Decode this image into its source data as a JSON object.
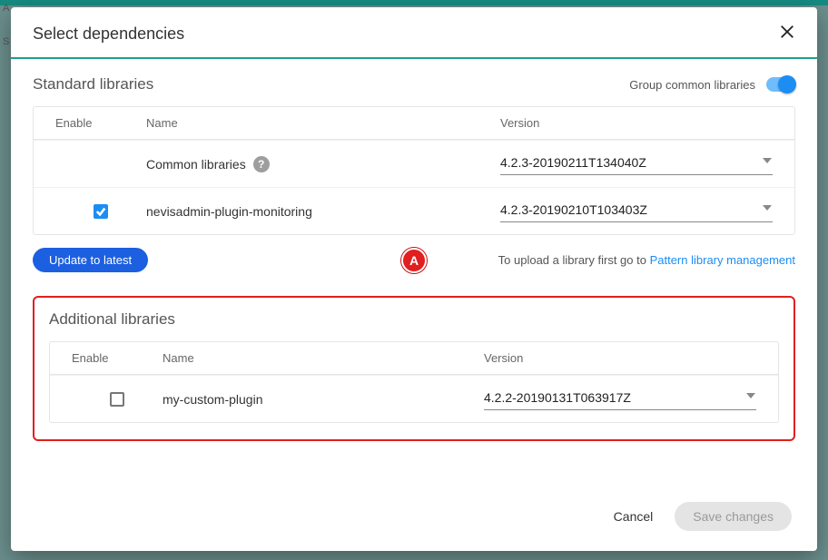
{
  "modal": {
    "title": "Select dependencies",
    "standard_section_title": "Standard libraries",
    "group_toggle_label": "Group common libraries",
    "columns": {
      "enable": "Enable",
      "name": "Name",
      "version": "Version"
    },
    "standard_rows": {
      "row0": {
        "name": "Common libraries",
        "version": "4.2.3-20190211T134040Z"
      },
      "row1": {
        "name": "nevisadmin-plugin-monitoring",
        "version": "4.2.3-20190210T103403Z"
      }
    },
    "update_button": "Update to latest",
    "callout": "A",
    "upload_hint_prefix": "To upload a library first go to ",
    "upload_hint_link": "Pattern library management",
    "additional_section_title": "Additional libraries",
    "additional_rows": {
      "row0": {
        "name": "my-custom-plugin",
        "version": "4.2.2-20190131T063917Z"
      }
    },
    "footer": {
      "cancel": "Cancel",
      "save": "Save changes"
    }
  },
  "background": {
    "tab_a": "A",
    "tab_s": "S"
  }
}
